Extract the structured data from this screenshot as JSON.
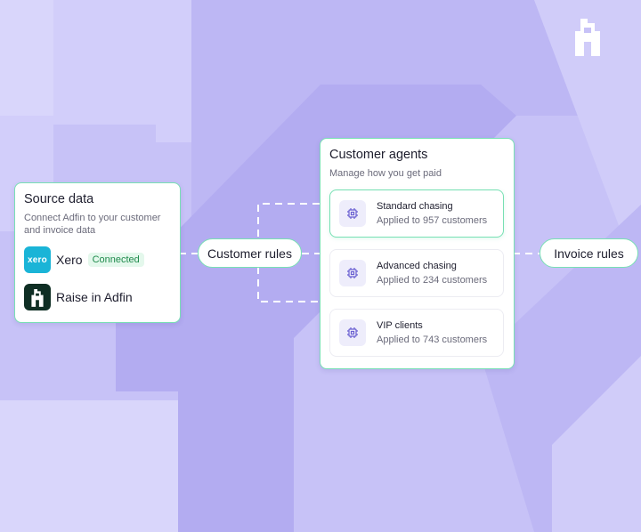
{
  "source_card": {
    "title": "Source data",
    "subtitle": "Connect Adfin to your customer and invoice data",
    "sources": [
      {
        "icon": "xero-icon",
        "icon_text": "xero",
        "name": "Xero",
        "badge": "Connected"
      },
      {
        "icon": "adfin-icon",
        "name": "Raise in Adfin"
      }
    ]
  },
  "rules": {
    "customer_rules": "Customer rules",
    "invoice_rules": "Invoice rules"
  },
  "agents_card": {
    "title": "Customer agents",
    "subtitle": "Manage how you get paid",
    "agents": [
      {
        "name": "Standard chasing",
        "description": "Applied to 957 customers",
        "selected": true
      },
      {
        "name": "Advanced chasing",
        "description": "Applied to 234 customers",
        "selected": false
      },
      {
        "name": "VIP clients",
        "description": "Applied to 743 customers",
        "selected": false
      }
    ]
  },
  "colors": {
    "background": "#c7c2f7",
    "shape_light": "#d9d6fb",
    "shape_dark": "#b3acf1",
    "accent_green": "#78e0b4",
    "xero_blue": "#1ab4d7",
    "adfin_dark": "#0f2e24",
    "chip_purple": "#6a5fd1"
  }
}
